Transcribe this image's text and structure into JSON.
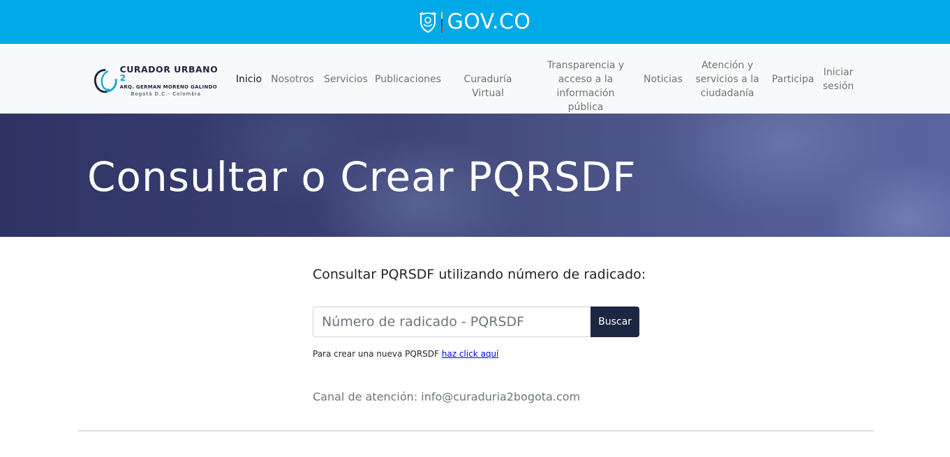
{
  "gov_bar": {
    "brand_text": "GOV.CO",
    "shield_icon": "colombia-coat-of-arms-icon",
    "color": "#00a9e8"
  },
  "logo": {
    "line1": "CURADOR URBANO",
    "line1_number": "2",
    "line2": "ARQ. GERMAN MORENO GALINDO",
    "line3": "Bogotá D.C.- Colombia"
  },
  "nav": {
    "items": [
      {
        "label": "Inicio",
        "active": true
      },
      {
        "label": "Nosotros"
      },
      {
        "label": "Servicios"
      },
      {
        "label": "Publicaciones"
      },
      {
        "label": "Curaduría Virtual"
      },
      {
        "label": "Transparencia y acceso a la información pública"
      },
      {
        "label": "Noticias"
      },
      {
        "label": "Atención y servicios a la ciudadanía"
      },
      {
        "label": "Participa"
      },
      {
        "label": "Iniciar sesión"
      }
    ]
  },
  "hero": {
    "title": "Consultar o Crear PQRSDF"
  },
  "consult": {
    "heading": "Consultar PQRSDF utilizando número de radicado:",
    "input_placeholder": "Número de radicado - PQRSDF",
    "input_value": "",
    "button_label": "Buscar",
    "create_text": "Para crear una nueva PQRSDF",
    "create_link": "haz click aquí"
  },
  "contact": {
    "text": "Canal de atención: info@curaduria2bogota.com"
  },
  "colors": {
    "accent_dark": "#1c2541",
    "accent_cyan": "#1aa7cf"
  }
}
